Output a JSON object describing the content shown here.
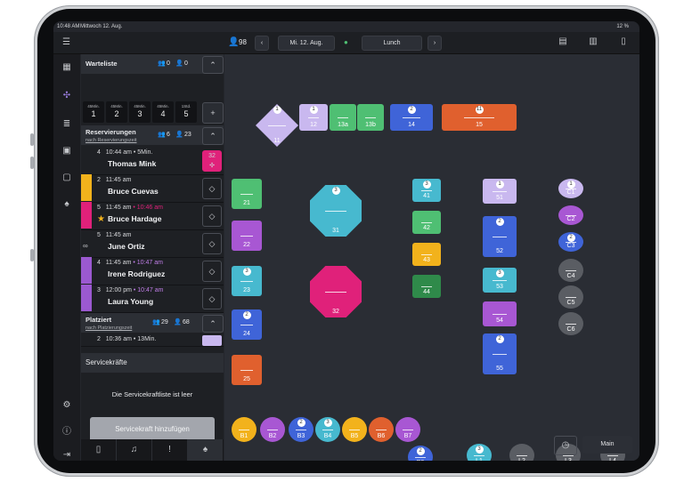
{
  "status_bar": {
    "time": "10:48 AM",
    "date": "Mittwoch 12. Aug.",
    "battery": "12 %"
  },
  "topbar": {
    "guests_count": "98",
    "date_label": "Mi. 12. Aug.",
    "shift_label": "Lunch"
  },
  "waitlist": {
    "title": "Warteliste",
    "groups": "0",
    "guests": "0",
    "slots": [
      {
        "label": "45Min.",
        "value": "1"
      },
      {
        "label": "45Min.",
        "value": "2"
      },
      {
        "label": "45Min.",
        "value": "3"
      },
      {
        "label": "45Min.",
        "value": "4"
      },
      {
        "label": "1Std.",
        "value": "5"
      }
    ]
  },
  "reservations": {
    "title": "Reservierungen",
    "sort": "nach Reservierungszeit",
    "groups": "6",
    "guests": "23",
    "items": [
      {
        "party": "4",
        "time": "10:44 am • 5Min.",
        "name": "Thomas Mink",
        "color": "#e0217a",
        "badge": "32"
      },
      {
        "party": "2",
        "time": "11:45 am",
        "name": "Bruce Cuevas",
        "color": "#f2b21c"
      },
      {
        "party": "5",
        "time": "11:45 am",
        "late": "• 10:46 am",
        "name": "Bruce Hardage",
        "color": "#e0217a"
      },
      {
        "party": "5",
        "time": "11:45 am",
        "name": "June Ortiz",
        "color": ""
      },
      {
        "party": "4",
        "time": "11:45 am",
        "late": "• 10:47 am",
        "name": "Irene Rodriguez",
        "color": "#9b59d0"
      },
      {
        "party": "3",
        "time": "12:00 pm",
        "late": "• 10:47 am",
        "name": "Laura Young",
        "color": "#9b59d0"
      }
    ]
  },
  "seated": {
    "title": "Platziert",
    "sort": "nach Platzierungszeit",
    "groups": "29",
    "guests": "68",
    "first": {
      "party": "2",
      "time": "10:36 am • 13Min."
    }
  },
  "staff": {
    "title": "Servicekräfte",
    "empty": "Die Servicekraftliste ist leer",
    "add_label": "Servicekraft hinzufügen"
  },
  "floor": {
    "room_label": "Main",
    "tables": [
      {
        "id": "11",
        "shape": "diamond",
        "color": "#c9b8ef",
        "guests": "1"
      },
      {
        "id": "12",
        "color": "#c9b8ef",
        "guests": "1"
      },
      {
        "id": "13a",
        "color": "#4fbf73"
      },
      {
        "id": "13b",
        "color": "#4fbf73"
      },
      {
        "id": "14",
        "color": "#3f64d8",
        "guests": "2"
      },
      {
        "id": "15",
        "color": "#e0602e",
        "guests": "11"
      },
      {
        "id": "21",
        "color": "#4fbf73"
      },
      {
        "id": "22",
        "color": "#a857d3"
      },
      {
        "id": "23",
        "color": "#47b9cf",
        "guests": "3"
      },
      {
        "id": "24",
        "color": "#3f64d8",
        "guests": "2"
      },
      {
        "id": "25",
        "color": "#e0602e"
      },
      {
        "id": "31",
        "shape": "oct",
        "color": "#47b9cf",
        "guests": "3"
      },
      {
        "id": "32",
        "shape": "oct",
        "color": "#e0217a"
      },
      {
        "id": "41",
        "color": "#47b9cf",
        "guests": "3"
      },
      {
        "id": "42",
        "color": "#4fbf73"
      },
      {
        "id": "43",
        "color": "#f2b21c"
      },
      {
        "id": "44",
        "color": "#2f8a4a"
      },
      {
        "id": "51",
        "color": "#c9b8ef",
        "guests": "1"
      },
      {
        "id": "52",
        "color": "#3f64d8",
        "guests": "2"
      },
      {
        "id": "53",
        "color": "#47b9cf",
        "guests": "3"
      },
      {
        "id": "54",
        "color": "#a857d3"
      },
      {
        "id": "55",
        "color": "#3f64d8",
        "guests": "2"
      },
      {
        "id": "C1",
        "color": "#c9b8ef",
        "guests": "1"
      },
      {
        "id": "C2",
        "color": "#a857d3"
      },
      {
        "id": "C3",
        "color": "#3f64d8",
        "guests": "2"
      },
      {
        "id": "C4",
        "color": "#5a5d63"
      },
      {
        "id": "C5",
        "color": "#5a5d63"
      },
      {
        "id": "C6",
        "color": "#5a5d63"
      },
      {
        "id": "B1",
        "color": "#f2b21c"
      },
      {
        "id": "B2",
        "color": "#a857d3"
      },
      {
        "id": "B3",
        "color": "#3f64d8",
        "guests": "2"
      },
      {
        "id": "B4",
        "color": "#47b9cf",
        "guests": "3"
      },
      {
        "id": "B5",
        "color": "#f2b21c"
      },
      {
        "id": "B6",
        "color": "#e0602e"
      },
      {
        "id": "B7",
        "color": "#a857d3"
      },
      {
        "id": "B8",
        "color": "#3f64d8",
        "guests": "2"
      },
      {
        "id": "L1",
        "color": "#47b9cf",
        "guests": "3"
      },
      {
        "id": "L2",
        "color": "#5a5d63"
      },
      {
        "id": "L3",
        "color": "#5a5d63"
      },
      {
        "id": "L4",
        "color": "#5a5d63"
      }
    ]
  }
}
